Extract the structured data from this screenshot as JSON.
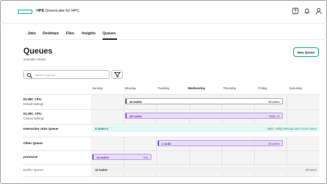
{
  "header": {
    "brand": "HPE",
    "product": "GreenLake for HPC"
  },
  "tabs": [
    {
      "label": "Jobs"
    },
    {
      "label": "Desktops"
    },
    {
      "label": "Files"
    },
    {
      "label": "Insights"
    },
    {
      "label": "Queues",
      "active": true
    }
  ],
  "page": {
    "title": "Queues",
    "subtitle": "Grenoble Cluster",
    "new_button": "New Queue",
    "search_placeholder": "Search queues"
  },
  "days": [
    "Sunday",
    "Monday",
    "Tuesday",
    "Wednesday",
    "Thursday",
    "Friday",
    "Saturday"
  ],
  "today": "Wednesday",
  "queues": [
    {
      "name": "DL380_CPU",
      "sub": "Default Settings",
      "bar_label": "32 nodes",
      "bar_right": "All Users"
    },
    {
      "name": "DL380_CPU",
      "sub": "Custom Settings",
      "bar_label": "48 nodes",
      "bar_right": "R&D, AI"
    },
    {
      "name": "Interactive Jobs Queue",
      "bar_label": "4 nodes €",
      "bar_right": "R&D, Gallig Renaud and 3 more users"
    },
    {
      "name": "Other Queue",
      "bar_label": "1 node",
      "bar_right": "All Users"
    },
    {
      "name": "provence",
      "bar_label": "14 nodes",
      "bar_right": "You"
    },
    {
      "name": "Buffer Queue",
      "bar_label": "12 nodes",
      "bar_right": "All Users"
    }
  ],
  "colors": {
    "accent": "#01a982",
    "purple": "#7c4fc8",
    "teal": "#0e8a73"
  },
  "icons": [
    "hpe-logo-icon",
    "help-icon",
    "bell-icon",
    "user-icon",
    "search-icon",
    "filter-icon"
  ]
}
